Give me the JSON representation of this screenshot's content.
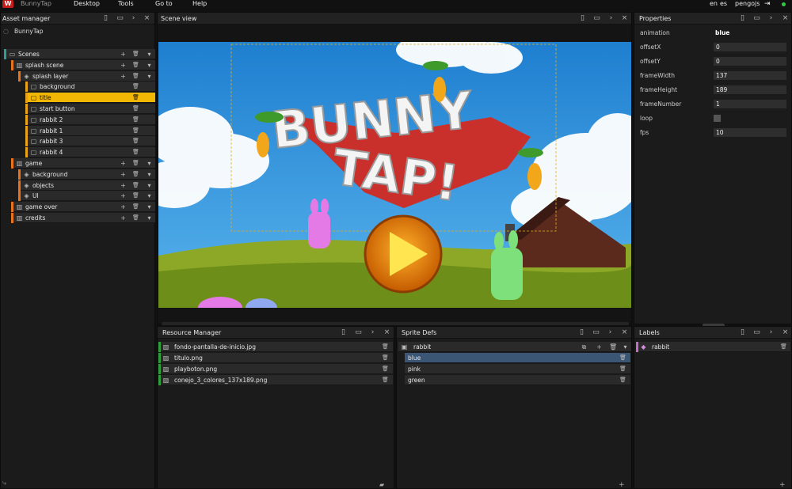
{
  "menu": {
    "logo": "W",
    "app_title": "BunnyTap",
    "items": [
      "Desktop",
      "Tools",
      "Go to",
      "Help"
    ],
    "lang_en": "en",
    "lang_es": "es",
    "user": "pengojs"
  },
  "asset_manager": {
    "title": "Asset manager",
    "project": "BunnyTap",
    "rows": [
      {
        "label": "Scenes",
        "level": 0
      },
      {
        "label": "splash scene",
        "level": 1
      },
      {
        "label": "splash layer",
        "level": 2
      },
      {
        "label": "background",
        "level": 3
      },
      {
        "label": "title",
        "level": 3,
        "selected": true
      },
      {
        "label": "start button",
        "level": 3
      },
      {
        "label": "rabbit 2",
        "level": 3
      },
      {
        "label": "rabbit 1",
        "level": 3
      },
      {
        "label": "rabbit 3",
        "level": 3
      },
      {
        "label": "rabbit 4",
        "level": 3
      },
      {
        "label": "game",
        "level": 1
      },
      {
        "label": "background",
        "level": 2
      },
      {
        "label": "objects",
        "level": 2
      },
      {
        "label": "UI",
        "level": 2
      },
      {
        "label": "game over",
        "level": 1
      },
      {
        "label": "credits",
        "level": 1
      }
    ]
  },
  "scene_view": {
    "title": "Scene view",
    "logo_line1": "BUNNY",
    "logo_line2": "TAP!"
  },
  "properties": {
    "title": "Properties",
    "rows": [
      {
        "key": "animation",
        "value": "blue"
      },
      {
        "key": "offsetX",
        "value": "0"
      },
      {
        "key": "offsetY",
        "value": "0"
      },
      {
        "key": "frameWidth",
        "value": "137"
      },
      {
        "key": "frameHeight",
        "value": "189"
      },
      {
        "key": "frameNumber",
        "value": "1"
      },
      {
        "key": "loop",
        "value": ""
      },
      {
        "key": "fps",
        "value": "10"
      }
    ]
  },
  "resource_manager": {
    "title": "Resource Manager",
    "files": [
      "fondo-pantalla-de-inicio.jpg",
      "titulo.png",
      "playboton.png",
      "conejo_3_colores_137x189.png"
    ]
  },
  "sprite_defs": {
    "title": "Sprite Defs",
    "sprite": "rabbit",
    "animations": [
      "blue",
      "pink",
      "green"
    ]
  },
  "labels": {
    "title": "Labels",
    "items": [
      "rabbit"
    ]
  },
  "colors": {
    "accent": "#f2b705",
    "scene_bar": "#e8731a",
    "green_bar": "#2f9e3a",
    "sky": "#2f8fd8"
  }
}
